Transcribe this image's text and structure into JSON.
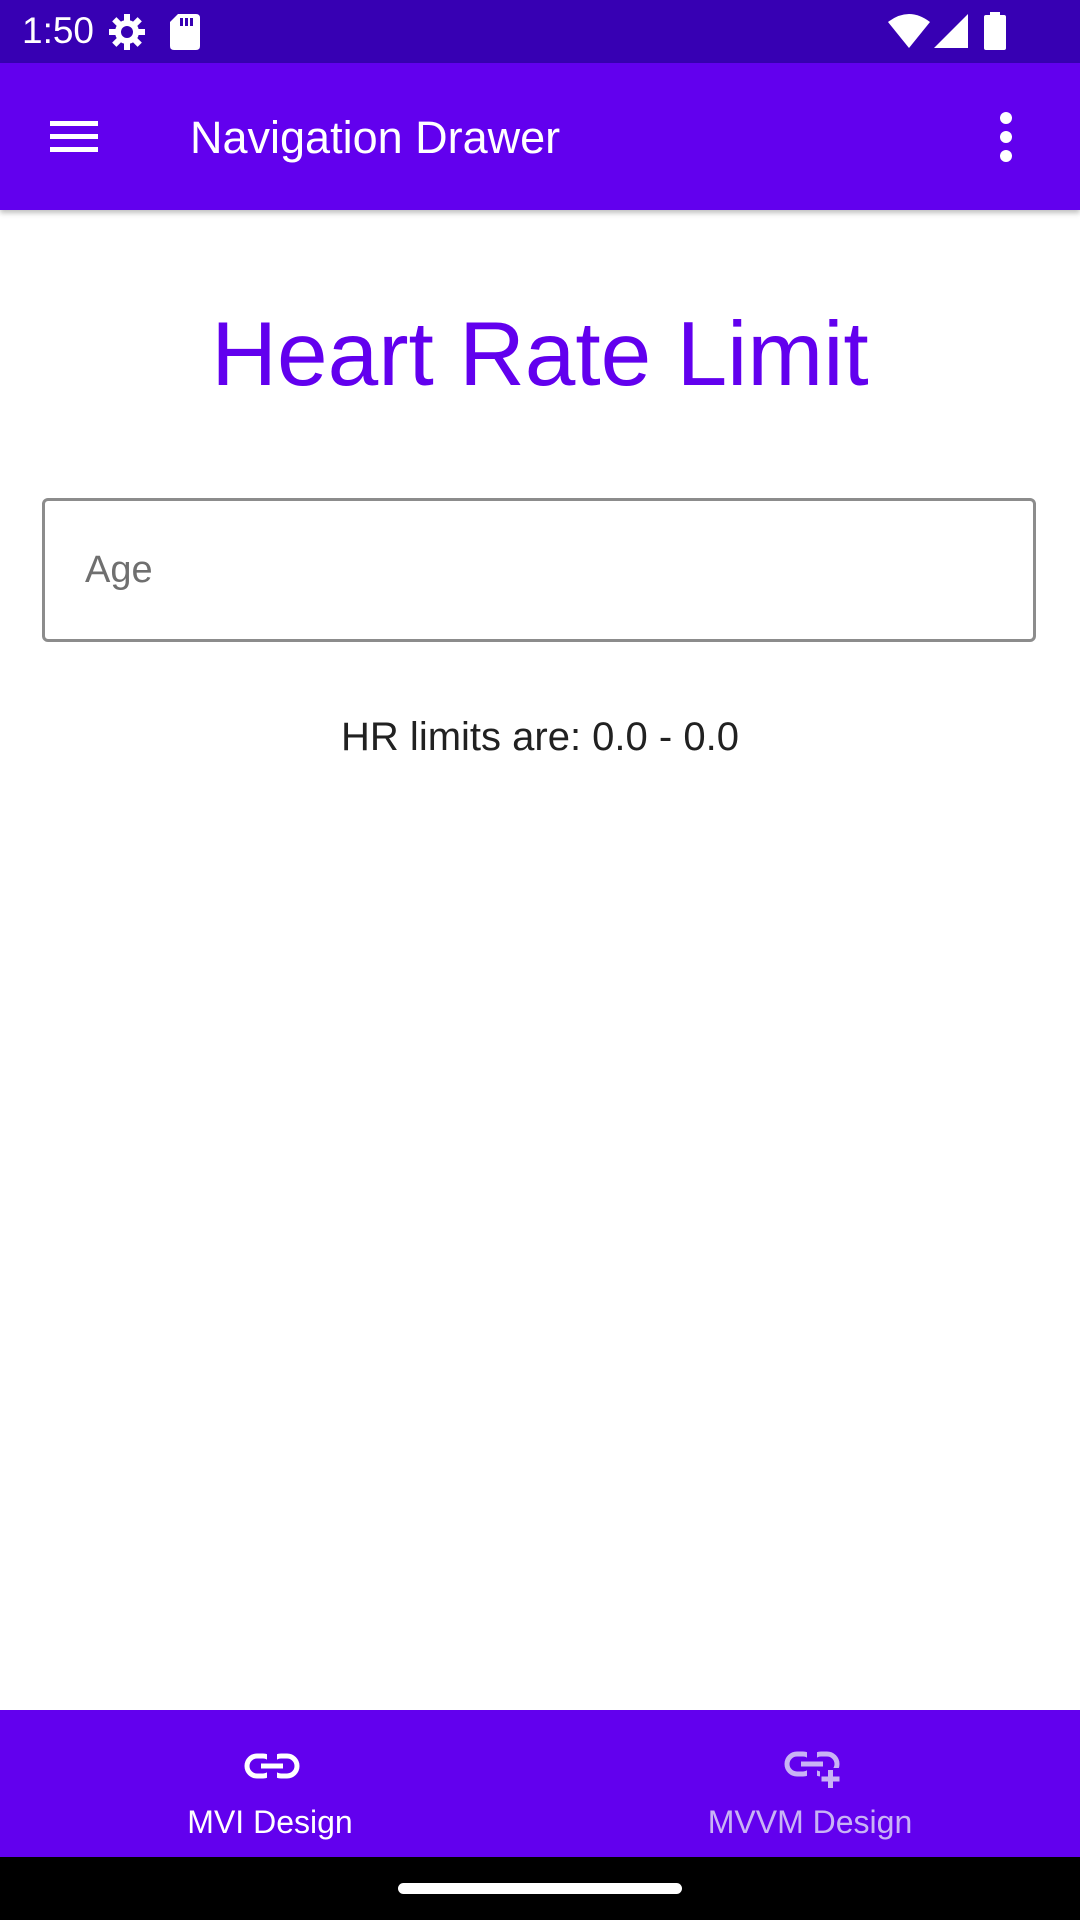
{
  "status_bar": {
    "time": "1:50",
    "icons": [
      "settings-icon",
      "sd-card-icon",
      "wifi-icon",
      "signal-icon",
      "battery-icon"
    ]
  },
  "app_bar": {
    "title": "Navigation Drawer",
    "menu_icon": "hamburger-menu-icon",
    "overflow_icon": "more-vert-icon"
  },
  "main": {
    "title": "Heart Rate Limit",
    "age_field": {
      "placeholder": "Age",
      "value": ""
    },
    "result_text": "HR limits are: 0.0 - 0.0"
  },
  "bottom_nav": {
    "items": [
      {
        "label": "MVI Design",
        "icon": "link-icon",
        "active": true
      },
      {
        "label": "MVVM Design",
        "icon": "add-link-icon",
        "active": false
      }
    ]
  },
  "colors": {
    "status_bar": "#3700b3",
    "primary": "#6200ee",
    "on_primary": "#ffffff",
    "inactive_nav": "#c9b3f5",
    "text": "#212121"
  }
}
